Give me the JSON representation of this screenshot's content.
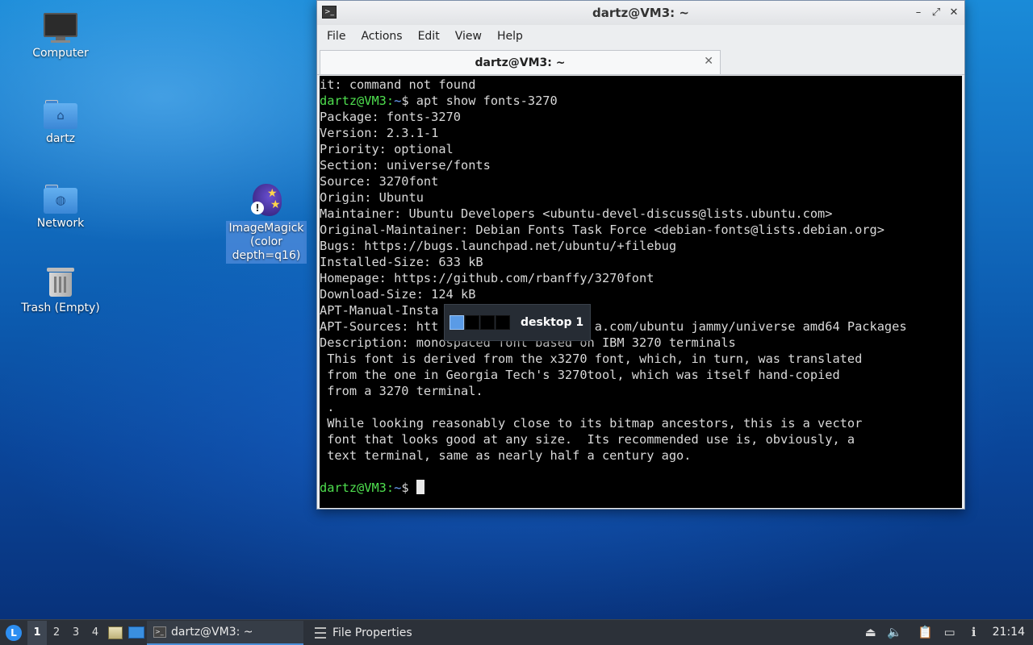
{
  "desktop": {
    "icons": [
      {
        "label": "Computer",
        "icon": "computer-icon"
      },
      {
        "label": "dartz",
        "icon": "home-folder-icon"
      },
      {
        "label": "Network",
        "icon": "network-folder-icon"
      },
      {
        "label": "Trash (Empty)",
        "icon": "trash-icon"
      },
      {
        "label": "ImageMagick (color depth=q16)",
        "icon": "imagemagick-icon"
      }
    ]
  },
  "window": {
    "title": "dartz@VM3: ~",
    "menu": [
      "File",
      "Actions",
      "Edit",
      "View",
      "Help"
    ],
    "tab_title": "dartz@VM3: ~",
    "prompt": {
      "user": "dartz@VM3",
      "sep": ":",
      "path": "~",
      "symbol": "$ "
    },
    "lines": [
      {
        "text": "it: command not found"
      },
      {
        "prompt": true,
        "text": "apt show fonts-3270"
      },
      {
        "text": "Package: fonts-3270"
      },
      {
        "text": "Version: 2.3.1-1"
      },
      {
        "text": "Priority: optional"
      },
      {
        "text": "Section: universe/fonts"
      },
      {
        "text": "Source: 3270font"
      },
      {
        "text": "Origin: Ubuntu"
      },
      {
        "text": "Maintainer: Ubuntu Developers <ubuntu-devel-discuss@lists.ubuntu.com>"
      },
      {
        "text": "Original-Maintainer: Debian Fonts Task Force <debian-fonts@lists.debian.org>"
      },
      {
        "text": "Bugs: https://bugs.launchpad.net/ubuntu/+filebug"
      },
      {
        "text": "Installed-Size: 633 kB"
      },
      {
        "text": "Homepage: https://github.com/rbanffy/3270font"
      },
      {
        "text": "Download-Size: 124 kB"
      },
      {
        "text": "APT-Manual-Insta"
      },
      {
        "text": "APT-Sources: htt                     a.com/ubuntu jammy/universe amd64 Packages"
      },
      {
        "text": "Description: monospaced font based on IBM 3270 terminals"
      },
      {
        "text": " This font is derived from the x3270 font, which, in turn, was translated"
      },
      {
        "text": " from the one in Georgia Tech's 3270tool, which was itself hand-copied"
      },
      {
        "text": " from a 3270 terminal."
      },
      {
        "text": " ."
      },
      {
        "text": " While looking reasonably close to its bitmap ancestors, this is a vector"
      },
      {
        "text": " font that looks good at any size.  Its recommended use is, obviously, a"
      },
      {
        "text": " text terminal, same as nearly half a century ago."
      },
      {
        "text": ""
      },
      {
        "prompt": true,
        "text": "",
        "cursor": true
      }
    ]
  },
  "osd": {
    "label": "desktop 1",
    "workspaces": 4,
    "active": 1
  },
  "taskbar": {
    "pager": [
      "1",
      "2",
      "3",
      "4"
    ],
    "active_desktop": "1",
    "tasks": [
      {
        "label": "dartz@VM3: ~",
        "icon": "terminal-icon",
        "active": true
      },
      {
        "label": "File Properties",
        "icon": "properties-icon",
        "active": false
      }
    ],
    "clock": "21:14"
  },
  "colors": {
    "prompt_user": "#4fe04f",
    "prompt_path": "#6fa4ff",
    "terminal_bg": "#000000",
    "accent": "#4a8fd8"
  }
}
